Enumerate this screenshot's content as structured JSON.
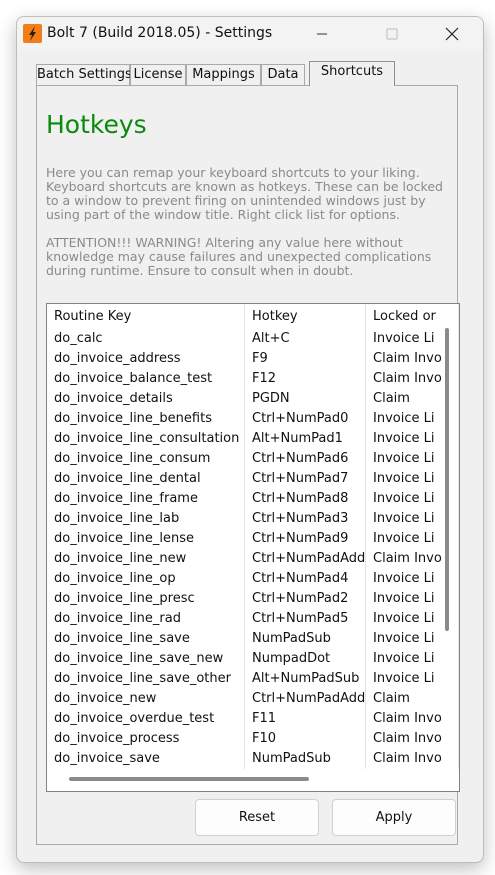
{
  "window": {
    "title": "Bolt 7 (Build 2018.05) - Settings"
  },
  "tabs": [
    "Batch Settings",
    "License",
    "Mappings",
    "Data",
    "Shortcuts"
  ],
  "active_tab": "Shortcuts",
  "content": {
    "heading": "Hotkeys",
    "description": "Here you can remap your keyboard shortcuts to your liking. Keyboard shortcuts are known as hotkeys. These can be locked to a window to prevent firing on unintended windows just by using part of the window title. Right click list for options.",
    "warning": "ATTENTION!!! WARNING! Altering any value here without knowledge may cause failures and unexpected complications during runtime. Ensure to consult when in doubt."
  },
  "table": {
    "columns": [
      "Routine Key",
      "Hotkey",
      "Locked or"
    ],
    "rows": [
      [
        "do_calc",
        "Alt+C",
        "Invoice Li"
      ],
      [
        "do_invoice_address",
        "F9",
        "Claim Invo"
      ],
      [
        "do_invoice_balance_test",
        "F12",
        "Claim Invo"
      ],
      [
        "do_invoice_details",
        "PGDN",
        "Claim"
      ],
      [
        "do_invoice_line_benefits",
        "Ctrl+NumPad0",
        "Invoice Li"
      ],
      [
        "do_invoice_line_consultation",
        "Alt+NumPad1",
        "Invoice Li"
      ],
      [
        "do_invoice_line_consum",
        "Ctrl+NumPad6",
        "Invoice Li"
      ],
      [
        "do_invoice_line_dental",
        "Ctrl+NumPad7",
        "Invoice Li"
      ],
      [
        "do_invoice_line_frame",
        "Ctrl+NumPad8",
        "Invoice Li"
      ],
      [
        "do_invoice_line_lab",
        "Ctrl+NumPad3",
        "Invoice Li"
      ],
      [
        "do_invoice_line_lense",
        "Ctrl+NumPad9",
        "Invoice Li"
      ],
      [
        "do_invoice_line_new",
        "Ctrl+NumPadAdd",
        "Claim Invo"
      ],
      [
        "do_invoice_line_op",
        "Ctrl+NumPad4",
        "Invoice Li"
      ],
      [
        "do_invoice_line_presc",
        "Ctrl+NumPad2",
        "Invoice Li"
      ],
      [
        "do_invoice_line_rad",
        "Ctrl+NumPad5",
        "Invoice Li"
      ],
      [
        "do_invoice_line_save",
        "NumPadSub",
        "Invoice Li"
      ],
      [
        "do_invoice_line_save_new",
        "NumpadDot",
        "Invoice Li"
      ],
      [
        "do_invoice_line_save_other",
        "Alt+NumPadSub",
        "Invoice Li"
      ],
      [
        "do_invoice_new",
        "Ctrl+NumPadAdd",
        "Claim"
      ],
      [
        "do_invoice_overdue_test",
        "F11",
        "Claim Invo"
      ],
      [
        "do_invoice_process",
        "F10",
        "Claim Invo"
      ],
      [
        "do_invoice_save",
        "NumPadSub",
        "Claim Invo"
      ]
    ]
  },
  "buttons": {
    "reset": "Reset",
    "apply": "Apply"
  },
  "colors": {
    "heading": "#0a8a0a",
    "app_icon": "#f07d17"
  }
}
